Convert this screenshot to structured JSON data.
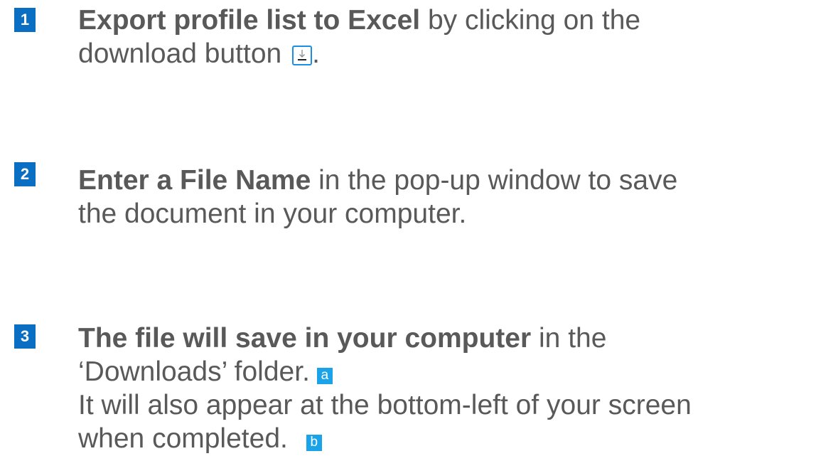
{
  "steps": [
    {
      "number": "1",
      "bold": "Export profile list to Excel",
      "text_a": " by clicking on the",
      "text_b": "download button ",
      "text_c": ".",
      "icon": "download-icon"
    },
    {
      "number": "2",
      "bold": "Enter a File Name",
      "text_a": " in the pop-up window to save",
      "text_b": "the document in your computer."
    },
    {
      "number": "3",
      "bold": "The file will save in your computer",
      "text_a": " in the",
      "text_b": "‘Downloads’ folder.",
      "marker_a": "a",
      "text_c": "It will also appear at the bottom-left of your screen",
      "text_d": "when completed.",
      "marker_b": "b"
    }
  ],
  "colors": {
    "badge": "#0a6fc2",
    "marker": "#1aa3e8",
    "text": "#595959",
    "icon_border": "#1a8fe3"
  }
}
